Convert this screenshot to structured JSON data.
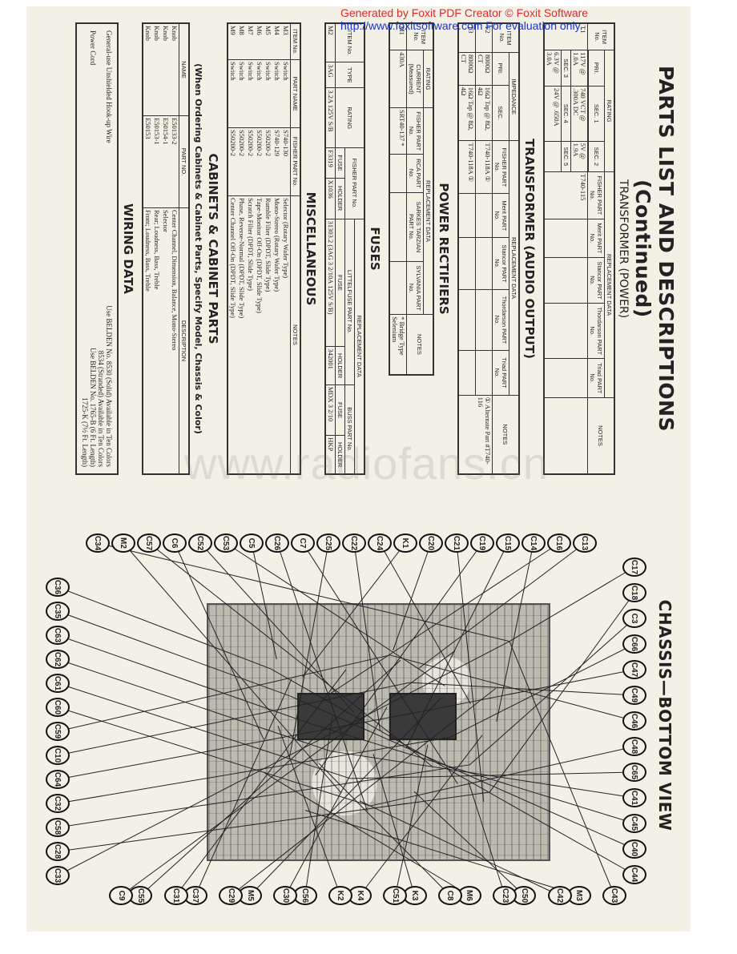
{
  "banner": {
    "line1": "Generated by Foxit PDF Creator © Foxit Software",
    "line2": "http://www.foxitsoftware.com   For evaluation only."
  },
  "watermark": "www.radiofans.cn",
  "document": {
    "title": "PARTS LIST AND DESCRIPTIONS (Continued)",
    "power_transformer": {
      "title": "TRANSFORMER (POWER)",
      "headers": {
        "item": "ITEM No.",
        "rating": "RATING",
        "pri": "PRI.",
        "sec1": "SEC. 1",
        "sec2": "SEC. 2",
        "sec3": "SEC. 3",
        "sec4": "SEC. 4",
        "sec5": "SEC. 5",
        "replacement": "REPLACEMENT DATA",
        "fisher": "FISHER PART No.",
        "merit": "Merit PART No.",
        "stancor": "Stancor PART No.",
        "thordarson": "Thordarson PART No.",
        "triad": "Triad PART No.",
        "notes": "NOTES"
      },
      "rows": [
        {
          "item": "T1",
          "pri": "117V @ 1.0A",
          "sec1": "740 VCT @ .300A DC",
          "sec2": "5V @ 1.9A",
          "sec3": "6.3V @ 3.0A",
          "sec4": "24V @ .650A",
          "sec5": "",
          "fisher": "T740-115",
          "merit": "",
          "stancor": "",
          "thordarson": "",
          "triad": "",
          "notes": ""
        }
      ]
    },
    "audio_transformer": {
      "title": "TRANSFORMER (AUDIO OUTPUT)",
      "headers": {
        "item": "ITEM No.",
        "impedance": "IMPEDANCE",
        "pri": "PRI.",
        "sec": "SEC.",
        "replacement": "REPLACEMENT DATA",
        "fisher": "FISHER PART No.",
        "merit": "Merit PART No.",
        "stancor": "Stancor PART No.",
        "thordarson": "Thordarson PART No.",
        "triad": "Triad PART No.",
        "notes": "NOTES"
      },
      "rows": [
        {
          "item": "T2",
          "pri": "8000Ω CT",
          "sec": "16Ω Tap @ 8Ω, 4Ω",
          "fisher": "T740-118A ①",
          "notes": "① Alternate Part #T740-116"
        },
        {
          "item": "T3",
          "pri": "8000Ω CT",
          "sec": "16Ω Tap @ 8Ω, 4Ω",
          "fisher": "T740-118A ①",
          "notes": ""
        }
      ]
    },
    "power_rectifiers": {
      "title": "POWER RECTIFIERS",
      "headers": {
        "item": "ITEM No.",
        "rating": "RATING",
        "current": "CURRENT (Measured)",
        "replacement": "REPLACEMENT DATA",
        "fisher": "FISHER PART No.",
        "rca": "RCA PART No.",
        "sarkes": "SARKES TARZIAN PART No.",
        "sylvania": "SYLVANIA PART No.",
        "notes": "NOTES"
      },
      "rows": [
        {
          "item": "M1",
          "current": "430A",
          "fisher": "SRT40-137 *",
          "rca": "",
          "sarkes": "",
          "sylvania": "",
          "notes": "* Bridge Type Selenium"
        }
      ]
    },
    "fuses": {
      "title": "FUSES",
      "headers": {
        "item": "ITEM No.",
        "type": "TYPE",
        "rating": "RATING",
        "replacement": "REPLACEMENT DATA",
        "fisher": "FISHER PART No.",
        "littelfuse": "LITTELFUSE PART No.",
        "buss": "BUSS PART No.",
        "fuse": "FUSE",
        "holder": "HOLDER"
      },
      "rows": [
        {
          "item": "M2",
          "type": "3AG",
          "rating": "3.2A 125V S/B",
          "fisher_fuse": "F3319",
          "fisher_holder": "X1036",
          "littelfuse_fuse": "31303.2 (3AG 3 2/10A 125V S/B)",
          "littelfuse_holder": "342001",
          "buss_fuse": "MDX 3 2/10",
          "buss_holder": "HKP"
        }
      ]
    },
    "miscellaneous": {
      "title": "MISCELLANEOUS",
      "headers": {
        "item": "ITEM No.",
        "part_name": "PART NAME",
        "fisher": "FISHER PART No.",
        "notes": "NOTES"
      },
      "rows": [
        {
          "item": "M3",
          "part_name": "Switch",
          "fisher": "S740-130",
          "notes": "Selector (Rotary Wafer Type)"
        },
        {
          "item": "M4",
          "part_name": "Switch",
          "fisher": "S740-129",
          "notes": "Mono-Stereo (Rotary Wafer Type)"
        },
        {
          "item": "M5",
          "part_name": "Switch",
          "fisher": "S50200-2",
          "notes": "Rumble Filter (DPDT, Slide Type)"
        },
        {
          "item": "M6",
          "part_name": "Switch",
          "fisher": "S50200-2",
          "notes": "Tape-Monitor Off-On (DPDT, Slide Type)"
        },
        {
          "item": "M7",
          "part_name": "Switch",
          "fisher": "S50200-2",
          "notes": "Scratch Filter (DPDT, Slide Type)"
        },
        {
          "item": "M8",
          "part_name": "Switch",
          "fisher": "S50200-2",
          "notes": "Phase, Reverse-Normal (DPDT, Slide Type)"
        },
        {
          "item": "M9",
          "part_name": "Switch",
          "fisher": "S50200-2",
          "notes": "Center Channel Off-On (DPDT, Slide Type)"
        }
      ]
    },
    "cabinets": {
      "title": "CABINETS & CABINET PARTS",
      "note": "(When Ordering Cabinets & Cabinet Parts, Specify Model, Chassis & Color)",
      "headers": {
        "name": "NAME",
        "part_no": "PART NO.",
        "description": "DESCRIPTION"
      },
      "rows": [
        {
          "name": "Knob",
          "part_no": "E50133-2",
          "description": "Center Channel, Dimension, Balance, Mono-Stereo"
        },
        {
          "name": "Knob",
          "part_no": "E50154-1",
          "description": "Selector"
        },
        {
          "name": "Knob",
          "part_no": "E50153-1",
          "description": "Rear; Loudness, Bass, Treble"
        },
        {
          "name": "Knob",
          "part_no": "E50153",
          "description": "Front; Loudness, Bass, Treble"
        }
      ]
    },
    "wiring": {
      "title": "WIRING DATA",
      "rows": [
        {
          "label": "General-use Unshielded Hook-up Wire",
          "value": "Use BELDEN No. 8530 (Solid) Available in Ten Colors",
          "value2": "8534 (Stranded) Available in Ten Colors"
        },
        {
          "label": "Power Cord",
          "value": "Use BELDEN No. 1765-B (6 Ft. Length)",
          "value2": "1725-K (7½ Ft. Length)"
        }
      ]
    }
  },
  "chassis": {
    "title": "CHASSIS—BOTTOM VIEW",
    "callouts_top": [
      "C17",
      "C18",
      "C3",
      "C66",
      "C47",
      "C49",
      "C46",
      "C48",
      "C65",
      "C41",
      "C45",
      "C40",
      "C44"
    ],
    "callouts_right": [
      "C43",
      "M3",
      "C42",
      "C50",
      "C23",
      "M6",
      "C8",
      "K3",
      "C51",
      "K4",
      "K2",
      "C56",
      "C30",
      "M5",
      "C29",
      "C37",
      "C31",
      "C55",
      "C9"
    ],
    "callouts_bottom": [
      "C33",
      "C28",
      "C58",
      "C32",
      "C64",
      "C10",
      "C59",
      "C60",
      "C61",
      "C62",
      "C63",
      "C35",
      "C36"
    ],
    "callouts_left": [
      "C34",
      "M2",
      "C57",
      "C6",
      "C52",
      "C53",
      "C5",
      "C26",
      "C7",
      "C25",
      "C22",
      "C24",
      "K1",
      "C20",
      "C21",
      "C19",
      "C15",
      "C14",
      "C16",
      "C13"
    ]
  }
}
